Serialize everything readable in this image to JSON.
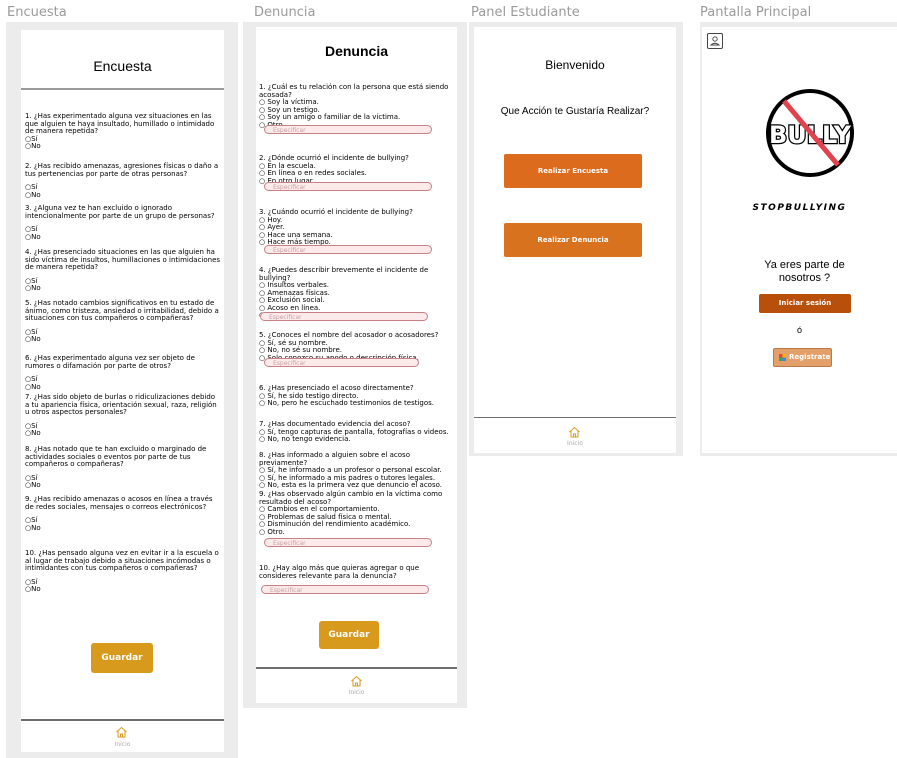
{
  "frames": {
    "encuesta": {
      "label": "Encuesta",
      "title": "Encuesta",
      "questions": [
        {
          "text": "1. ¿Has experimentado alguna vez situaciones en las que alguien te haya insultado, humillado o intimidado de manera repetida?",
          "options": [
            "Sí",
            "No"
          ]
        },
        {
          "text": "2. ¿Has recibido amenazas, agresiones físicas o daño a tus pertenencias por parte de otras personas?",
          "options": [
            "Sí",
            "No"
          ]
        },
        {
          "text": "3. ¿Alguna vez te han excluido o ignorado intencionalmente por parte de un grupo de personas?",
          "options": [
            "Sí",
            "No"
          ]
        },
        {
          "text": "4. ¿Has presenciado situaciones en las que alguien ha sido víctima de insultos, humillaciones o intimidaciones de manera repetida?",
          "options": [
            "Sí",
            "No"
          ]
        },
        {
          "text": "5. ¿Has notado cambios significativos en tu estado de ánimo, como tristeza, ansiedad o irritabilidad, debido a situaciones con tus compañeros o compañeras?",
          "options": [
            "Sí",
            "No"
          ]
        },
        {
          "text": "6. ¿Has experimentado alguna vez ser objeto de rumores o difamación por parte de otros?",
          "options": [
            "Sí",
            "No"
          ]
        },
        {
          "text": "7. ¿Has sido objeto de burlas o ridiculizaciones debido a tu apariencia física, orientación sexual, raza, religión u otros aspectos personales?",
          "options": [
            "Sí",
            "No"
          ]
        },
        {
          "text": "8. ¿Has notado que te han excluido o marginado de actividades sociales o eventos por parte de tus compañeros o compañeras?",
          "options": [
            "Sí",
            "No"
          ]
        },
        {
          "text": "9. ¿Has recibido amenazas o acosos en línea a través de redes sociales, mensajes o correos electrónicos?",
          "options": [
            "Sí",
            "No"
          ]
        },
        {
          "text": "10. ¿Has pensado alguna vez en evitar ir a la escuela o al lugar de trabajo debido a situaciones incómodas o intimidantes con tus compañeros o compañeras?",
          "options": [
            "Sí",
            "No"
          ]
        }
      ],
      "save_label": "Guardar",
      "nav_label": "Inicio"
    },
    "denuncia": {
      "label": "Denuncia",
      "title": "Denuncia",
      "specify_placeholder": "Especificar",
      "questions": [
        {
          "text": "1. ¿Cuál es tu relación con la persona que está siendo acosada?",
          "options": [
            "Soy la víctima.",
            "Soy un testigo.",
            "Soy un amigo o familiar de la víctima.",
            "Otro ."
          ],
          "specify": true
        },
        {
          "text": "2. ¿Dónde ocurrió el incidente de bullying?",
          "options": [
            "En la escuela.",
            "En línea o en redes sociales.",
            "En otro lugar."
          ],
          "specify": true
        },
        {
          "text": "3. ¿Cuándo ocurrió el incidente de bullying?",
          "options": [
            "Hoy.",
            "Ayer.",
            "Hace una semana.",
            "Hace más tiempo."
          ],
          "specify": true
        },
        {
          "text": "4. ¿Puedes describir brevemente el incidente de bullying?",
          "options": [
            "Insultos verbales.",
            "Amenazas físicas.",
            "Exclusión social.",
            "Acoso en línea.",
            "Otro."
          ],
          "specify": true
        },
        {
          "text": "5. ¿Conoces el nombre del acosador o acosadores?",
          "options": [
            "Sí, sé su nombre.",
            "No, no sé su nombre.",
            "Solo conozco su apodo o descripción física."
          ],
          "specify": true
        },
        {
          "text": "6. ¿Has presenciado el acoso directamente?",
          "options": [
            "Sí, he sido testigo directo.",
            "No, pero he escuchado testimonios de testigos."
          ],
          "specify": false
        },
        {
          "text": "7. ¿Has documentado evidencia del acoso?",
          "options": [
            "Sí, tengo capturas de pantalla, fotografías o videos.",
            "No, no tengo evidencia."
          ],
          "specify": false
        },
        {
          "text": "8. ¿Has informado a alguien sobre el acoso previamente?",
          "options": [
            "Sí, he informado a un profesor o personal escolar.",
            "Sí, he informado a mis padres o tutores legales.",
            "No, esta es la primera vez que denuncio el acoso."
          ],
          "specify": false
        },
        {
          "text": "9. ¿Has observado algún cambio en la víctima como resultado del acoso?",
          "options": [
            "Cambios en el comportamiento.",
            "Problemas de salud física o mental.",
            "Disminución del rendimiento académico.",
            "Otro."
          ],
          "specify": true
        },
        {
          "text": "10. ¿Hay algo más que quieras agregar o que consideres relevante para la denuncia?",
          "options": [],
          "specify": true
        }
      ],
      "save_label": "Guardar",
      "nav_label": "Inicio"
    },
    "panel": {
      "label": "Panel Estudiante",
      "welcome": "Bienvenido",
      "prompt": "Que Acción te Gustaría Realizar?",
      "survey_button": "Realizar Encuesta",
      "report_button": "Realizar Denuncia",
      "nav_label": "Inicio"
    },
    "principal": {
      "label": "Pantalla Principal",
      "logo_text": "BULLY",
      "brand": "STOPBULLYING",
      "question": "Ya eres parte de nosotros ?",
      "login_button": "Iniciar sesión",
      "or_text": "ó",
      "register_button": "Registrate"
    }
  },
  "colors": {
    "gold": "#d79a1c",
    "orange": "#dd6b1d",
    "dark_orange": "#b84f0a",
    "register": "#e3a06b",
    "specify_border": "#c97f86"
  }
}
